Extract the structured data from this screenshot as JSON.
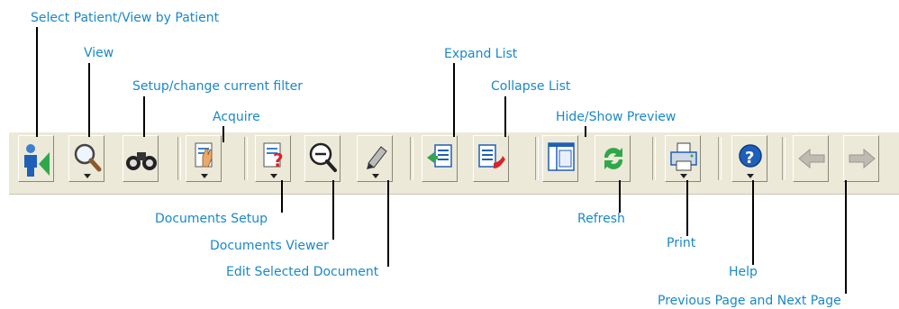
{
  "callouts": {
    "select_patient": "Select Patient/View by Patient",
    "view": "View",
    "setup_filter": "Setup/change current filter",
    "acquire": "Acquire",
    "expand_list": "Expand List",
    "collapse_list": "Collapse List",
    "hide_show_preview": "Hide/Show Preview",
    "documents_setup": "Documents Setup",
    "documents_viewer": "Documents Viewer",
    "edit_selected_document": "Edit Selected Document",
    "refresh": "Refresh",
    "print": "Print",
    "help": "Help",
    "previous_next_page": "Previous Page and Next Page"
  },
  "icons": {
    "select_patient": "person-arrow-icon",
    "view": "magnifier-icon",
    "setup_filter": "binoculars-icon",
    "acquire": "hand-document-icon",
    "documents_setup": "document-question-icon",
    "documents_viewer": "zoom-out-icon",
    "edit_selected_document": "pen-eraser-icon",
    "expand_list": "expand-list-icon",
    "collapse_list": "collapse-list-icon",
    "hide_show_preview": "preview-pane-icon",
    "refresh": "refresh-icon",
    "print": "printer-icon",
    "help": "help-icon",
    "previous_page": "arrow-left-icon",
    "next_page": "arrow-right-icon"
  },
  "colors": {
    "callout": "#1a88c9",
    "toolbar": "#ece9d8"
  }
}
